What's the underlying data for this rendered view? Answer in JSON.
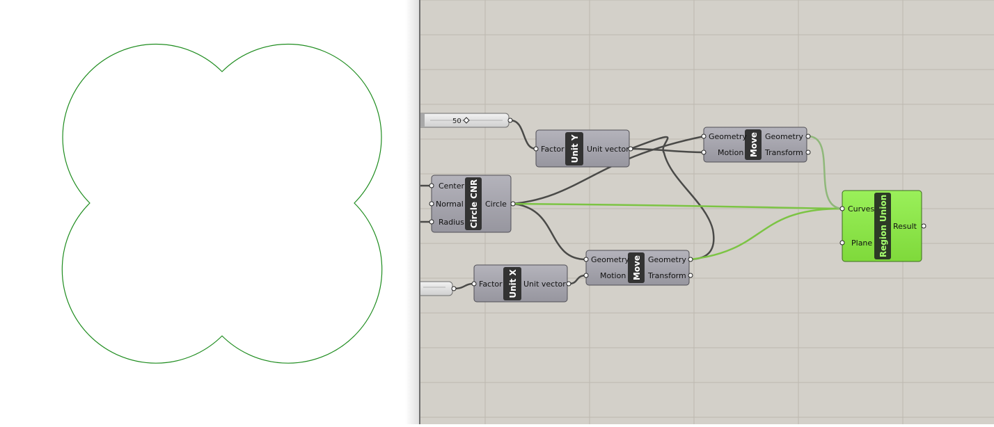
{
  "viewport": {
    "curve_color": "#1e8c1e"
  },
  "canvas": {
    "background": "#d3d0c9",
    "grid_color": "#bcb8b0"
  },
  "slider_top": {
    "value": "50"
  },
  "slider_bottom": {
    "value": ""
  },
  "components": {
    "unit_y": {
      "nickname": "Unit Y",
      "inputs": [
        "Factor"
      ],
      "outputs": [
        "Unit vector"
      ]
    },
    "unit_x": {
      "nickname": "Unit X",
      "inputs": [
        "Factor"
      ],
      "outputs": [
        "Unit vector"
      ]
    },
    "circle": {
      "nickname": "Circle CNR",
      "inputs": [
        "Center",
        "Normal",
        "Radius"
      ],
      "outputs": [
        "Circle"
      ]
    },
    "move_top": {
      "nickname": "Move",
      "inputs": [
        "Geometry",
        "Motion"
      ],
      "outputs": [
        "Geometry",
        "Transform"
      ]
    },
    "move_bottom": {
      "nickname": "Move",
      "inputs": [
        "Geometry",
        "Motion"
      ],
      "outputs": [
        "Geometry",
        "Transform"
      ]
    },
    "region_union": {
      "nickname": "Region Union",
      "inputs": [
        "Curves",
        "Plane"
      ],
      "outputs": [
        "Result"
      ],
      "color": "#8ee34a"
    }
  },
  "wire_colors": {
    "default": "#4a4a48",
    "selected": "#7cc444"
  }
}
